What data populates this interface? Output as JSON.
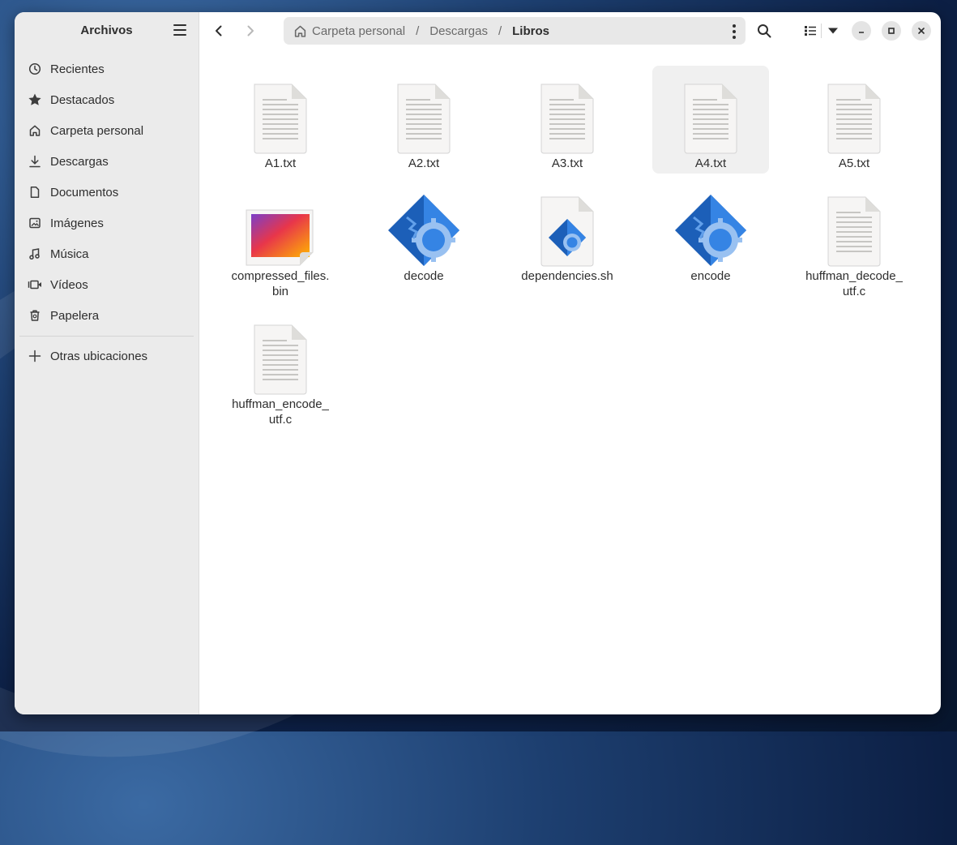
{
  "app": {
    "title": "Archivos"
  },
  "sidebar": {
    "items": [
      {
        "label": "Recientes",
        "icon": "clock-icon"
      },
      {
        "label": "Destacados",
        "icon": "star-icon"
      },
      {
        "label": "Carpeta personal",
        "icon": "home-icon"
      },
      {
        "label": "Descargas",
        "icon": "download-icon"
      },
      {
        "label": "Documentos",
        "icon": "document-icon"
      },
      {
        "label": "Imágenes",
        "icon": "image-icon"
      },
      {
        "label": "Música",
        "icon": "music-icon"
      },
      {
        "label": "Vídeos",
        "icon": "video-icon"
      },
      {
        "label": "Papelera",
        "icon": "trash-icon"
      }
    ],
    "other_locations": {
      "label": "Otras ubicaciones",
      "icon": "plus-icon"
    }
  },
  "pathbar": {
    "crumbs": [
      "Carpeta personal",
      "Descargas",
      "Libros"
    ],
    "separator": "/"
  },
  "files": [
    {
      "name": "A1.txt",
      "type": "text"
    },
    {
      "name": "A2.txt",
      "type": "text"
    },
    {
      "name": "A3.txt",
      "type": "text"
    },
    {
      "name": "A4.txt",
      "type": "text",
      "hovered": true
    },
    {
      "name": "A5.txt",
      "type": "text"
    },
    {
      "name": "compressed_files.bin",
      "type": "binary"
    },
    {
      "name": "decode",
      "type": "executable"
    },
    {
      "name": "dependencies.sh",
      "type": "script"
    },
    {
      "name": "encode",
      "type": "executable"
    },
    {
      "name": "huffman_decode_utf.c",
      "type": "text"
    },
    {
      "name": "huffman_encode_utf.c",
      "type": "text"
    }
  ],
  "colors": {
    "accent_blue": "#3584e4",
    "exec_dark": "#1c5fb8",
    "exec_light": "#62a0ea"
  }
}
